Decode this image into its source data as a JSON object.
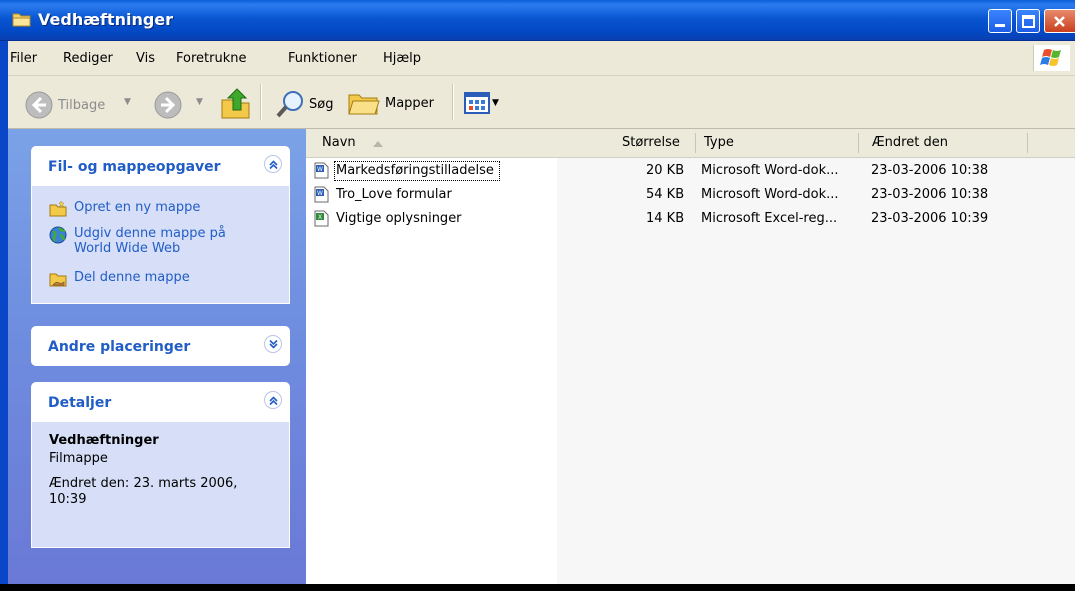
{
  "window": {
    "title": "Vedhæftninger"
  },
  "menu": {
    "items": [
      "Filer",
      "Rediger",
      "Vis",
      "Foretrukne",
      "Funktioner",
      "Hjælp"
    ]
  },
  "toolbar": {
    "back_label": "Tilbage",
    "search_label": "Søg",
    "folders_label": "Mapper"
  },
  "taskpane": {
    "file_tasks": {
      "title": "Fil- og mappeopgaver",
      "items": [
        {
          "label": "Opret en ny mappe",
          "icon": "new-folder-icon"
        },
        {
          "label": "Udgiv denne mappe på World Wide Web",
          "icon": "publish-web-icon"
        },
        {
          "label": "Del denne mappe",
          "icon": "share-folder-icon"
        }
      ]
    },
    "other_places": {
      "title": "Andre placeringer"
    },
    "details": {
      "title": "Detaljer",
      "name": "Vedhæftninger",
      "kind": "Filmappe",
      "modified": "Ændret den: 23. marts 2006, 10:39"
    }
  },
  "filelist": {
    "columns": [
      "Navn",
      "Størrelse",
      "Type",
      "Ændret den"
    ],
    "rows": [
      {
        "name": "Markedsføringstilladelse",
        "size": "20 KB",
        "type": "Microsoft Word-dok...",
        "modified": "23-03-2006 10:38",
        "icon": "word-document-icon"
      },
      {
        "name": "Tro_Love formular",
        "size": "54 KB",
        "type": "Microsoft Word-dok...",
        "modified": "23-03-2006 10:38",
        "icon": "word-document-icon"
      },
      {
        "name": "Vigtige oplysninger",
        "size": "14 KB",
        "type": "Microsoft Excel-reg...",
        "modified": "23-03-2006 10:39",
        "icon": "excel-workbook-icon"
      }
    ]
  },
  "colors": {
    "titlebar": "#0a56d2",
    "taskpane_link": "#215dc6",
    "taskpane_bg": "#6f8fe0"
  }
}
